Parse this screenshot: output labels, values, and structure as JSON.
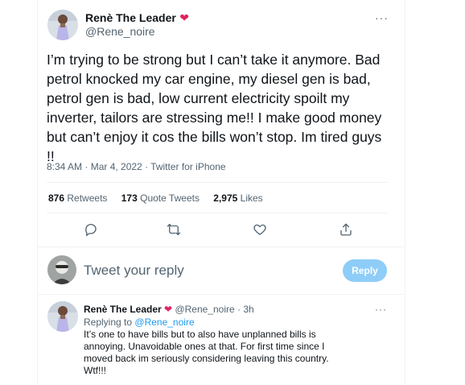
{
  "tweet": {
    "author_name": "Renè The Leader",
    "author_emoji": "❤",
    "handle": "@Rene_noire",
    "more_label": "···",
    "text": "I’m trying to be strong but I can’t take it anymore. Bad petrol knocked my car engine, my diesel gen is bad, petrol gen is bad, low current electricity spoilt my inverter, tailors are stressing me!! I make good money but can’t enjoy it cos the bills won’t stop. Im tired guys !!",
    "timestamp": "8:34 AM · Mar 4, 2022 · Twitter for iPhone"
  },
  "stats": {
    "retweets_count": "876",
    "retweets_label": "Retweets",
    "quotes_count": "173",
    "quotes_label": "Quote Tweets",
    "likes_count": "2,975",
    "likes_label": "Likes"
  },
  "actions": {
    "icons": [
      "reply-icon",
      "retweet-icon",
      "like-icon",
      "share-icon"
    ]
  },
  "composer": {
    "placeholder": "Tweet your reply",
    "reply_button": "Reply"
  },
  "reply": {
    "author_name": "Renè The Leader",
    "author_emoji": "❤",
    "handle": "@Rene_noire",
    "separator": "·",
    "time": "3h",
    "replying_prefix": "Replying to",
    "replying_to": "@Rene_noire",
    "more_label": "···",
    "text": "It’s one to have bills but to also have unplanned bills is annoying. Unavoidable ones at that. For first time since I moved back im seriously considering leaving this country. Wtf!!!"
  },
  "colors": {
    "accent": "#1d9bf0",
    "reply_button_disabled": "#8ecdf8",
    "heart": "#e0245e",
    "muted": "#536471"
  }
}
